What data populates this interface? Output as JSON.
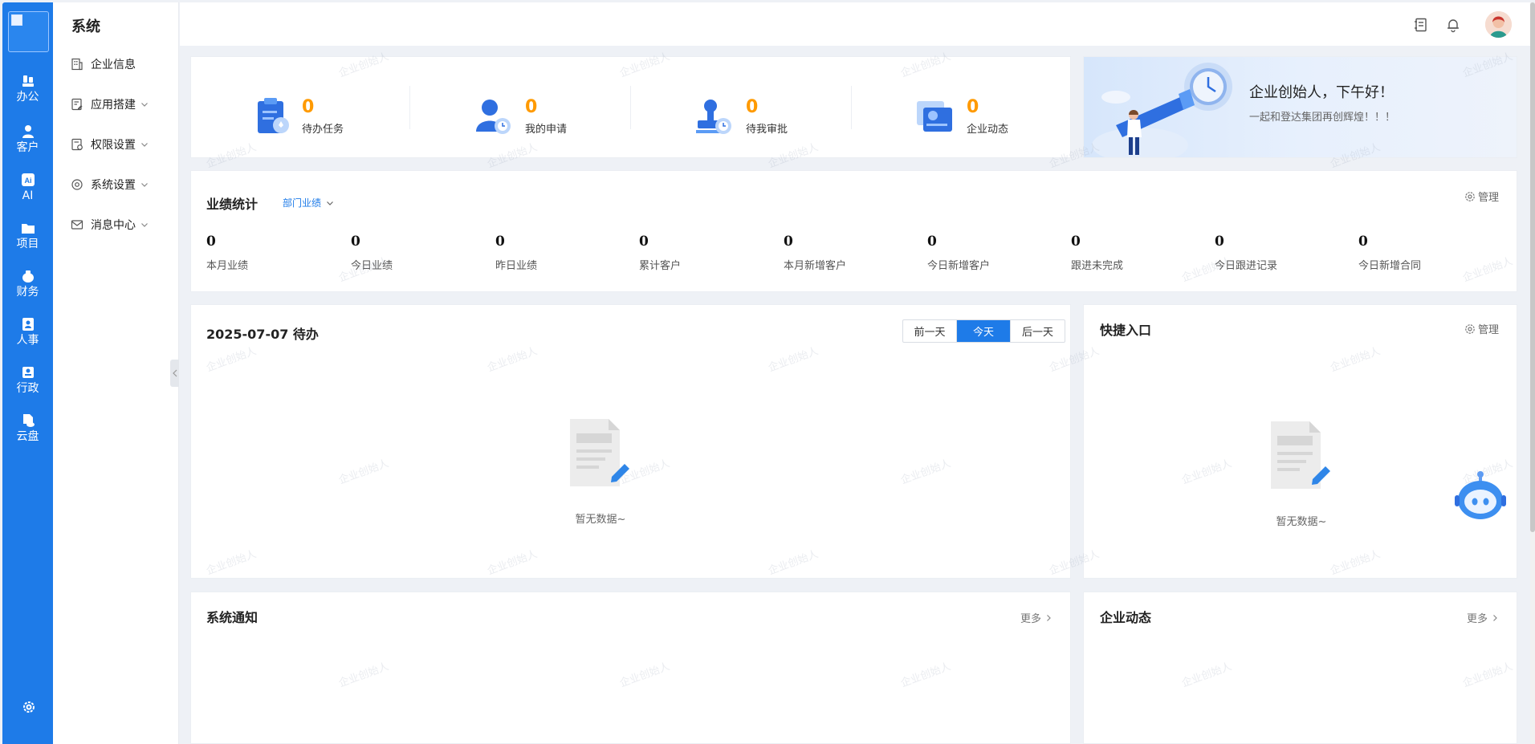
{
  "rail": {
    "items": [
      {
        "label": "办公",
        "icon": "office-icon"
      },
      {
        "label": "客户",
        "icon": "customer-icon"
      },
      {
        "label": "AI",
        "icon": "ai-icon"
      },
      {
        "label": "项目",
        "icon": "folder-icon"
      },
      {
        "label": "财务",
        "icon": "money-bag-icon"
      },
      {
        "label": "人事",
        "icon": "person-badge-icon"
      },
      {
        "label": "行政",
        "icon": "admin-icon"
      },
      {
        "label": "云盘",
        "icon": "cloud-file-icon"
      }
    ],
    "settings_icon": "gear-icon"
  },
  "sidebar": {
    "title": "系统",
    "items": [
      {
        "label": "企业信息",
        "icon": "building-icon",
        "expandable": false
      },
      {
        "label": "应用搭建",
        "icon": "app-build-icon",
        "expandable": true
      },
      {
        "label": "权限设置",
        "icon": "permission-icon",
        "expandable": true
      },
      {
        "label": "系统设置",
        "icon": "settings-icon",
        "expandable": true
      },
      {
        "label": "消息中心",
        "icon": "mail-icon",
        "expandable": true
      }
    ]
  },
  "topbar": {
    "icons": [
      "notebook-icon",
      "bell-icon",
      "avatar"
    ]
  },
  "stats": [
    {
      "value": "0",
      "label": "待办任务",
      "icon": "clipboard-icon"
    },
    {
      "value": "0",
      "label": "我的申请",
      "icon": "user-clock-icon"
    },
    {
      "value": "0",
      "label": "待我审批",
      "icon": "stamp-clock-icon"
    },
    {
      "value": "0",
      "label": "企业动态",
      "icon": "news-icon"
    }
  ],
  "banner": {
    "title": "企业创始人，下午好！",
    "subtitle": "一起和登达集团再创辉煌！！！"
  },
  "performance": {
    "title": "业绩统计",
    "filter": "部门业绩",
    "manage": "管理",
    "items": [
      {
        "value": "0",
        "label": "本月业绩"
      },
      {
        "value": "0",
        "label": "今日业绩"
      },
      {
        "value": "0",
        "label": "昨日业绩"
      },
      {
        "value": "0",
        "label": "累计客户"
      },
      {
        "value": "0",
        "label": "本月新增客户"
      },
      {
        "value": "0",
        "label": "今日新增客户"
      },
      {
        "value": "0",
        "label": "跟进未完成"
      },
      {
        "value": "0",
        "label": "今日跟进记录"
      },
      {
        "value": "0",
        "label": "今日新增合同"
      }
    ]
  },
  "todo": {
    "title": "2025-07-07 待办",
    "buttons": [
      "前一天",
      "今天",
      "后一天"
    ],
    "active": "今天",
    "empty": "暂无数据~"
  },
  "quick": {
    "title": "快捷入口",
    "manage": "管理",
    "empty": "暂无数据~"
  },
  "notice": {
    "title": "系统通知",
    "more": "更多"
  },
  "news": {
    "title": "企业动态",
    "more": "更多"
  },
  "watermark": "企业创始人",
  "colors": {
    "primary": "#1e7be8",
    "accent": "#ff9a00",
    "bg": "#eef1f6"
  }
}
